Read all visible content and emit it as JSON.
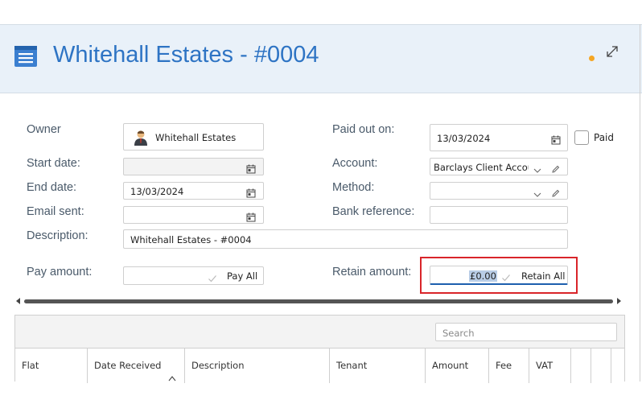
{
  "header": {
    "title": "Whitehall Estates - #0004"
  },
  "form": {
    "owner": {
      "label": "Owner",
      "value": "Whitehall Estates"
    },
    "start_date": {
      "label": "Start date:",
      "value": ""
    },
    "end_date": {
      "label": "End date:",
      "value": "13/03/2024"
    },
    "email_sent": {
      "label": "Email sent:",
      "value": ""
    },
    "description": {
      "label": "Description:",
      "value": "Whitehall Estates - #0004"
    },
    "pay_amount": {
      "label": "Pay amount:",
      "button": "Pay All"
    },
    "paid_out_on": {
      "label": "Paid out on:",
      "value": "13/03/2024"
    },
    "paid": {
      "label": "Paid",
      "checked": false
    },
    "account": {
      "label": "Account:",
      "value": "Barclays Client Accou"
    },
    "method": {
      "label": "Method:",
      "value": ""
    },
    "bank_reference": {
      "label": "Bank reference:",
      "value": ""
    },
    "retain_amount": {
      "label": "Retain amount:",
      "value": "£0.00",
      "button": "Retain All"
    }
  },
  "grid": {
    "search_placeholder": "Search",
    "columns": [
      "Flat",
      "Date Received",
      "Description",
      "Tenant",
      "Amount",
      "Fee",
      "VAT"
    ]
  },
  "colors": {
    "accent": "#2e74c4",
    "highlight_box": "#d9252a",
    "status_dot": "#f5a623"
  },
  "icons": [
    "list-icon",
    "expand-icon",
    "calendar-icon",
    "chevron-down-icon",
    "pencil-icon",
    "check-icon",
    "person-icon"
  ]
}
